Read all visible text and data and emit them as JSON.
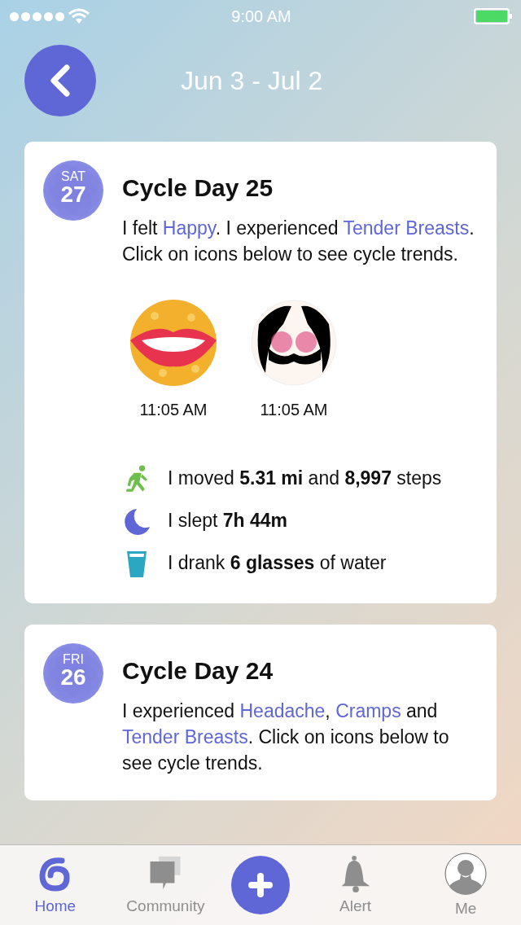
{
  "status_bar": {
    "time": "9:00 AM"
  },
  "header": {
    "title": "Jun 3 - Jul 2"
  },
  "entries": [
    {
      "weekday": "SAT",
      "day": "27",
      "title": "Cycle Day 25",
      "description": [
        {
          "kind": "plain",
          "text": "I felt "
        },
        {
          "kind": "symptom",
          "text": "Happy"
        },
        {
          "kind": "plain",
          "text": ". I experienced "
        },
        {
          "kind": "symptom",
          "text": "Tender Breasts"
        },
        {
          "kind": "plain",
          "text": ". Click on icons below to see cycle trends."
        }
      ],
      "logs": [
        {
          "kind": "happy",
          "time": "11:05 AM"
        },
        {
          "kind": "tender_breasts",
          "time": "11:05 AM"
        }
      ],
      "stats": [
        {
          "kind": "activity",
          "text": "I moved **5.31 mi** and **8,997** steps"
        },
        {
          "kind": "sleep",
          "text": "I slept **7h 44m**"
        },
        {
          "kind": "water",
          "text": "I drank **6 glasses** of water"
        }
      ]
    },
    {
      "weekday": "FRI",
      "day": "26",
      "title": "Cycle Day 24",
      "description": [
        {
          "kind": "plain",
          "text": "I experienced "
        },
        {
          "kind": "symptom",
          "text": "Headache"
        },
        {
          "kind": "plain",
          "text": ", "
        },
        {
          "kind": "symptom",
          "text": "Cramps"
        },
        {
          "kind": "plain",
          "text": " and "
        },
        {
          "kind": "symptom",
          "text": "Tender Breasts"
        },
        {
          "kind": "plain",
          "text": ". Click on icons below to see cycle trends."
        }
      ]
    }
  ],
  "tab_bar": [
    {
      "kind": "home",
      "label": "Home",
      "selected": true
    },
    {
      "kind": "community",
      "label": "Community",
      "selected": false
    },
    {
      "kind": "add",
      "selected": false
    },
    {
      "kind": "alert",
      "label": "Alert",
      "selected": false
    },
    {
      "kind": "me",
      "label": "Me",
      "selected": false
    }
  ]
}
